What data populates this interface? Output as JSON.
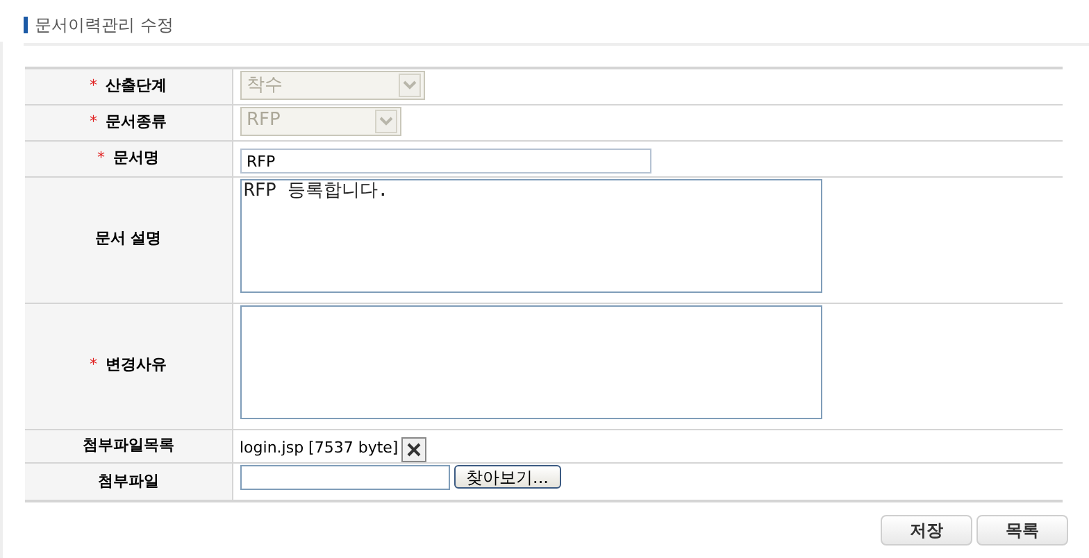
{
  "section_title": "문서이력관리 수정",
  "fields": [
    {
      "kind": "select",
      "label": "산출단계",
      "required_mark": "*",
      "value": "착수",
      "disabled": true
    },
    {
      "kind": "select",
      "label": "문서종류",
      "required_mark": "*",
      "value": "RFP",
      "disabled": true
    },
    {
      "kind": "text",
      "label": "문서명",
      "required_mark": "*",
      "value": "RFP"
    },
    {
      "kind": "textarea",
      "label": "문서 설명",
      "value": "RFP 등록합니다."
    },
    {
      "kind": "textarea",
      "label": "변경사유",
      "required_mark": "*"
    },
    {
      "kind": "files",
      "label": "첨부파일목록",
      "value": "login.jsp [7537 byte]"
    },
    {
      "kind": "file",
      "label": "첨부파일",
      "button": "찾아보기..."
    }
  ],
  "buttons": [
    "저장",
    "목록"
  ]
}
